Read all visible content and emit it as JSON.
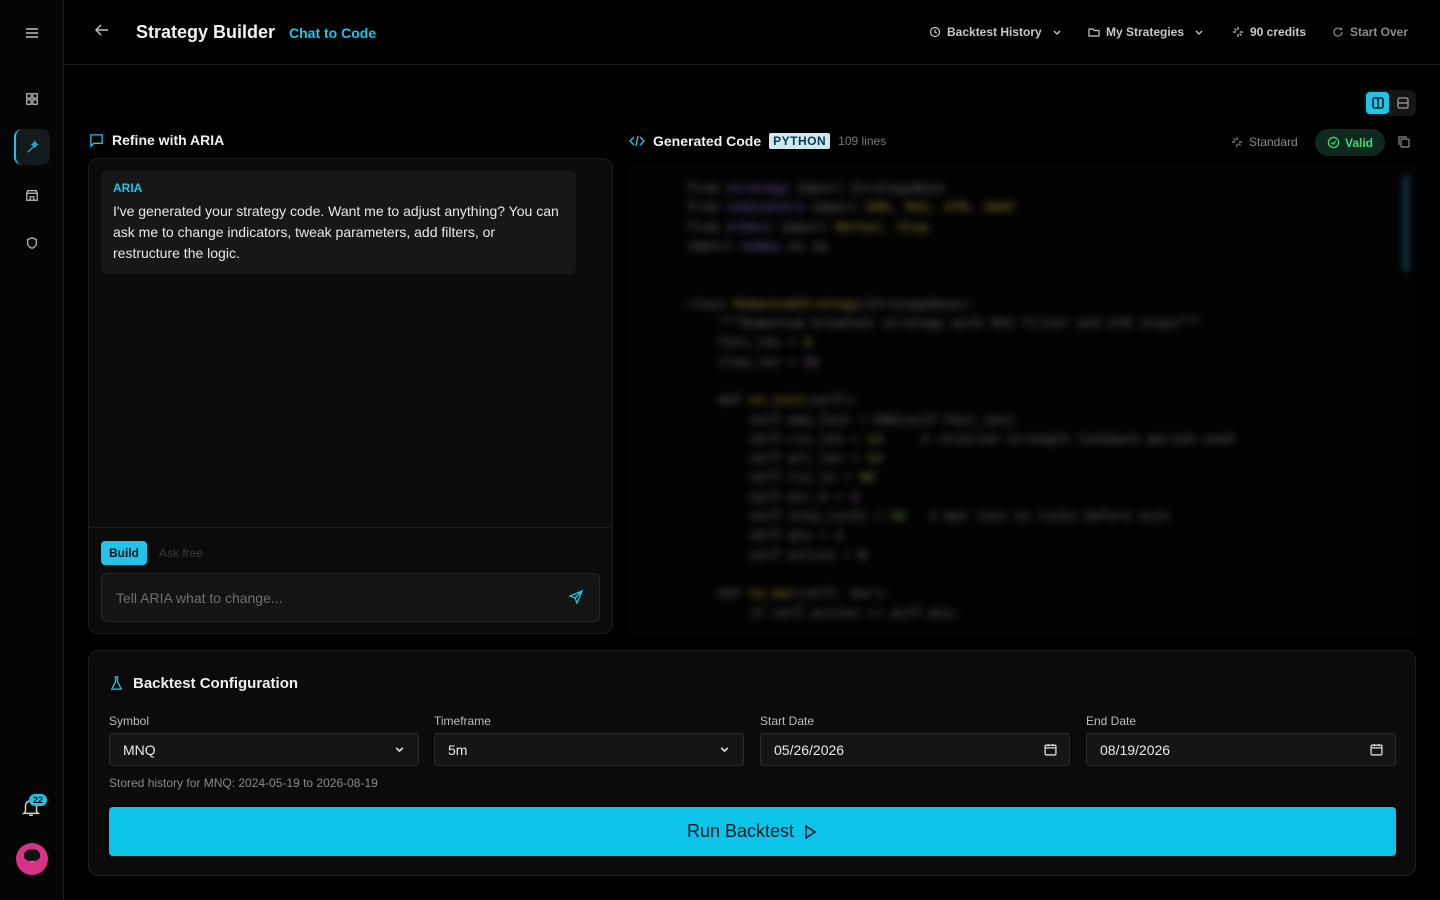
{
  "sidebar": {
    "icons": [
      "menu-icon",
      "dashboard-icon",
      "strategy-builder-icon",
      "store-icon",
      "shield-icon"
    ],
    "notification_count": "22"
  },
  "header": {
    "title": "Strategy Builder",
    "subtitle": "Chat to Code",
    "backtest_history": "Backtest History",
    "my_strategies": "My Strategies",
    "credits": "90 credits",
    "start_over": "Start Over"
  },
  "chat": {
    "heading": "Refine with ARIA",
    "sender": "ARIA",
    "message": "I've generated your strategy code. Want me to adjust anything? You can ask me to change indicators, tweak parameters, add filters, or restructure the logic.",
    "mode_build": "Build",
    "mode_ask": "Ask free",
    "input_placeholder": "Tell ARIA what to change..."
  },
  "code": {
    "heading": "Generated Code",
    "language": "PYTHON",
    "line_count": "109 lines",
    "mode": "Standard",
    "status": "Valid"
  },
  "backtest": {
    "heading": "Backtest Configuration",
    "symbol_label": "Symbol",
    "symbol_value": "MNQ",
    "timeframe_label": "Timeframe",
    "timeframe_value": "5m",
    "start_label": "Start Date",
    "start_value": "05/26/2026",
    "end_label": "End Date",
    "end_value": "08/19/2026",
    "history_note": "Stored history for MNQ: 2024-05-19 to 2026-08-19",
    "run_label": "Run Backtest"
  },
  "colors": {
    "accent": "#22c3e6",
    "valid": "#3ddc84",
    "background": "#000000"
  }
}
